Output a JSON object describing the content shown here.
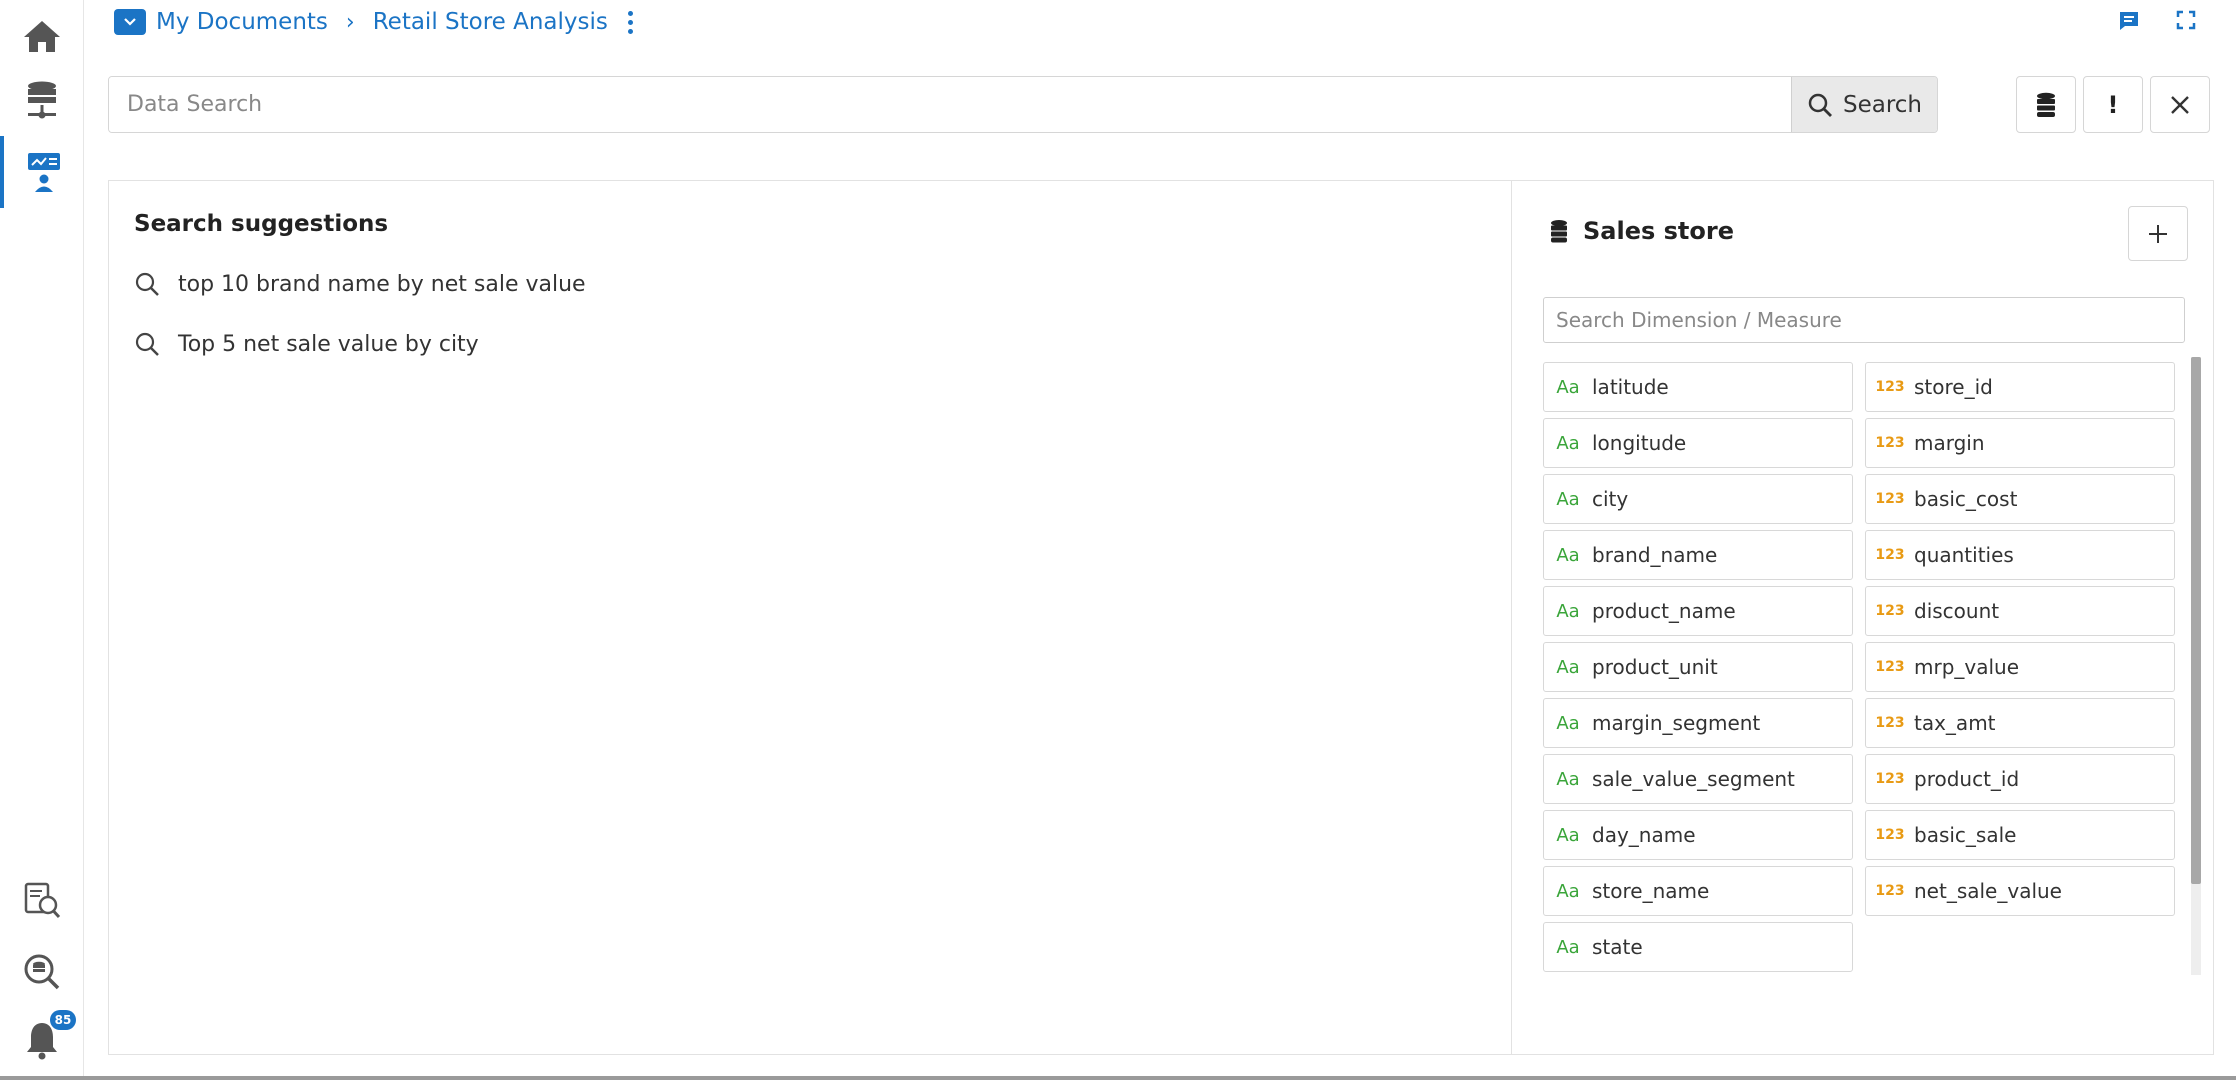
{
  "breadcrumb": {
    "root_label": "My Documents",
    "current_label": "Retail Store Analysis"
  },
  "search": {
    "placeholder": "Data Search",
    "button_label": "Search"
  },
  "tools": {
    "info_label": "!"
  },
  "notifications": {
    "count": "85"
  },
  "suggestions": {
    "title": "Search suggestions",
    "items": [
      "top 10 brand name by net sale value",
      "Top 5 net sale value by city"
    ]
  },
  "datasource": {
    "name": "Sales store",
    "field_search_placeholder": "Search Dimension / Measure",
    "type_labels": {
      "dimension": "Aa",
      "measure": "123"
    },
    "dimensions": [
      "latitude",
      "longitude",
      "city",
      "brand_name",
      "product_name",
      "product_unit",
      "margin_segment",
      "sale_value_segment",
      "day_name",
      "store_name",
      "state"
    ],
    "measures": [
      "store_id",
      "margin",
      "basic_cost",
      "quantities",
      "discount",
      "mrp_value",
      "tax_amt",
      "product_id",
      "basic_sale",
      "net_sale_value"
    ]
  },
  "colors": {
    "accent": "#1b74c5",
    "dimension": "#3aa53a",
    "measure": "#e89a14"
  },
  "icons": {
    "rail": [
      "home-icon",
      "database-network-icon",
      "dashboard-user-icon",
      "report-search-icon",
      "data-explore-icon",
      "bell-icon"
    ]
  }
}
